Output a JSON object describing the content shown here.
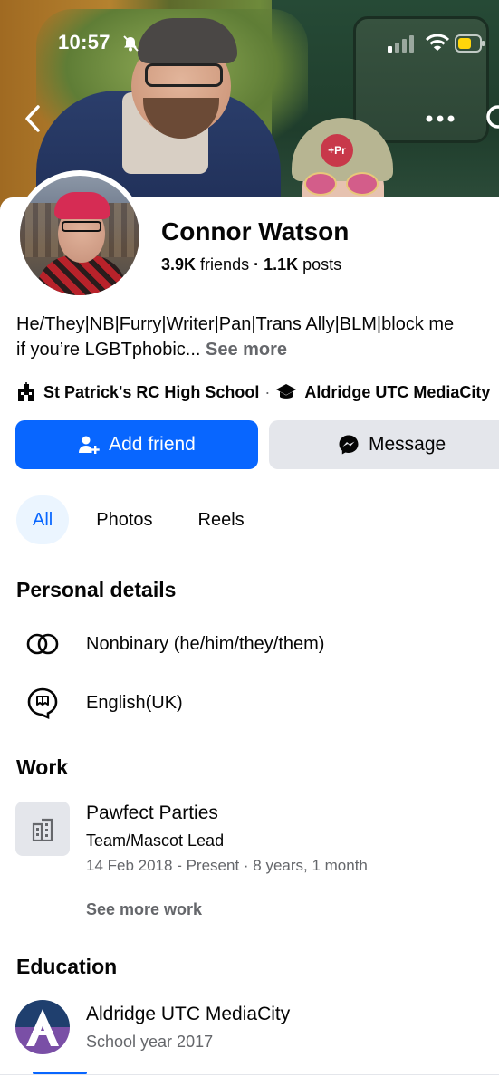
{
  "status_bar": {
    "time": "10:57"
  },
  "profile": {
    "name": "Connor Watson",
    "friends_count": "3.9K",
    "friends_label": "friends",
    "separator": "·",
    "posts_count": "1.1K",
    "posts_label": "posts",
    "bio_line1": "He/They|NB|Furry|Writer|Pan|Trans Ally|BLM|block me",
    "bio_line2": "if you’re LGBTphobic...",
    "see_more": "See more",
    "school1": "St Patrick's RC High School",
    "school2": "Aldridge UTC MediaCity"
  },
  "actions": {
    "add_friend": "Add friend",
    "message": "Message"
  },
  "tabs": [
    {
      "label": "All",
      "active": true
    },
    {
      "label": "Photos",
      "active": false
    },
    {
      "label": "Reels",
      "active": false
    }
  ],
  "personal_details": {
    "title": "Personal details",
    "gender": "Nonbinary (he/him/they/them)",
    "language": "English(UK)"
  },
  "work": {
    "title": "Work",
    "company": "Pawfect Parties",
    "role": "Team/Mascot Lead",
    "dates": "14 Feb 2018 - Present · 8 years, 1 month",
    "see_more": "See more work"
  },
  "education": {
    "title": "Education",
    "school": "Aldridge UTC MediaCity",
    "year": "School year 2017"
  },
  "icons": {
    "back": "back-arrow-icon",
    "more": "more-icon",
    "search": "search-icon",
    "school": "school-building-icon",
    "graduation": "graduation-cap-icon",
    "add_friend": "add-person-icon",
    "messenger": "messenger-icon",
    "gender": "gender-rings-icon",
    "language": "speech-bubble-icon",
    "work": "building-icon"
  },
  "colors": {
    "accent": "#0866ff",
    "secondary_text": "#65676b",
    "button_gray": "#e4e6eb",
    "active_tab_bg": "#ebf5ff"
  }
}
